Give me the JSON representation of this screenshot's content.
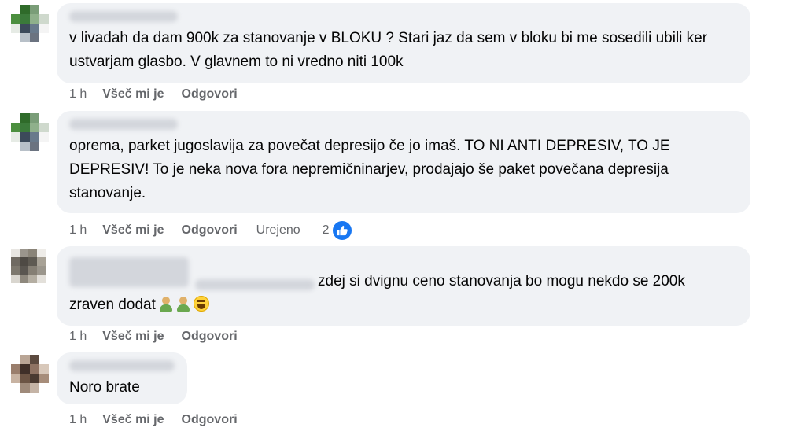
{
  "comments": [
    {
      "text": "v livadah da dam 900k za stanovanje v BLOKU ? Stari jaz da sem v bloku bi me sosedili ubili ker ustvarjam glasbo. V glavnem to ni vredno niti 100k",
      "time": "1 h",
      "like_label": "Všeč mi je",
      "reply_label": "Odgovori"
    },
    {
      "text": "oprema, parket jugoslavija za povečat depresijo če jo imaš. TO NI ANTI DEPRESIV, TO JE DEPRESIV! To je neka nova fora nepremičninarjev, prodajajo še paket povečana depresija stanovanje.",
      "time": "1 h",
      "like_label": "Všeč mi je",
      "reply_label": "Odgovori",
      "edited_label": "Urejeno",
      "reaction_count": "2"
    },
    {
      "text_line1": "zdej si dvignu ceno stanovanja bo mogu nekdo se 200k",
      "text_line2": "zraven dodat",
      "time": "1 h",
      "like_label": "Všeč mi je",
      "reply_label": "Odgovori"
    },
    {
      "text": "Noro brate",
      "time": "1 h",
      "like_label": "Všeč mi je",
      "reply_label": "Odgovori"
    }
  ],
  "colors": {
    "bubble": "#f0f2f5",
    "meta_text": "#65676b",
    "like_blue": "#1877f2"
  },
  "icons": {
    "reaction": "thumbs-up-icon",
    "emoji_1": "person-emoji-icon",
    "emoji_2": "person-emoji-icon",
    "emoji_3": "laughing-face-emoji-icon"
  }
}
